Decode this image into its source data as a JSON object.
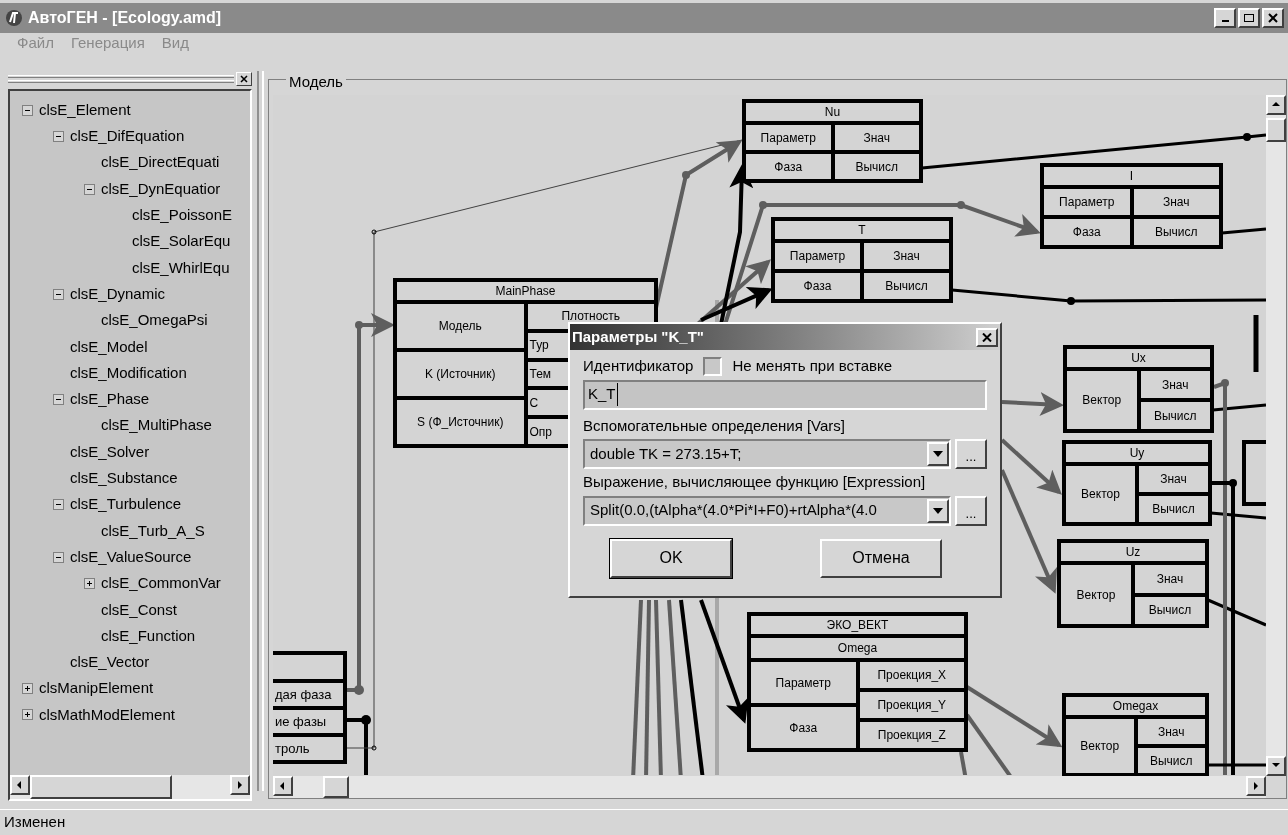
{
  "window": {
    "title": "АвтоГЕН - [Ecology.amd]"
  },
  "menu": [
    "Файл",
    "Генерация",
    "Вид"
  ],
  "tree": [
    {
      "label": "clsE_Element",
      "expanded": true,
      "children": [
        {
          "label": "clsE_DifEquation",
          "expanded": true,
          "children": [
            {
              "label": "clsE_DirectEquati"
            },
            {
              "label": "clsE_DynEquatior",
              "expanded": true,
              "children": [
                {
                  "label": "clsE_PoissonE"
                },
                {
                  "label": "clsE_SolarEqu"
                },
                {
                  "label": "clsE_WhirlEqu"
                }
              ]
            }
          ]
        },
        {
          "label": "clsE_Dynamic",
          "expanded": true,
          "children": [
            {
              "label": "clsE_OmegaPsi"
            }
          ]
        },
        {
          "label": "clsE_Model"
        },
        {
          "label": "clsE_Modification"
        },
        {
          "label": "clsE_Phase",
          "expanded": true,
          "children": [
            {
              "label": "clsE_MultiPhase"
            }
          ]
        },
        {
          "label": "clsE_Solver"
        },
        {
          "label": "clsE_Substance"
        },
        {
          "label": "clsE_Turbulence",
          "expanded": true,
          "children": [
            {
              "label": "clsE_Turb_A_S"
            }
          ]
        },
        {
          "label": "clsE_ValueSource",
          "expanded": true,
          "children": [
            {
              "label": "clsE_CommonVar",
              "expanded": false
            },
            {
              "label": "clsE_Const"
            },
            {
              "label": "clsE_Function"
            }
          ]
        },
        {
          "label": "clsE_Vector"
        }
      ]
    },
    {
      "label": "clsManipElement",
      "expanded": false
    },
    {
      "label": "clsMathModElement",
      "expanded": false
    }
  ],
  "model": {
    "title": "Модель",
    "nodes": [
      {
        "kind": "table",
        "title": "Nu",
        "left": [
          "Параметр",
          "Фаза"
        ],
        "right": [
          "Знач",
          "Вычисл"
        ]
      },
      {
        "kind": "table",
        "title": "I",
        "left": [
          "Параметр",
          "Фаза"
        ],
        "right": [
          "Знач",
          "Вычисл"
        ]
      },
      {
        "kind": "table",
        "title": "T",
        "left": [
          "Параметр",
          "Фаза"
        ],
        "right": [
          "Знач",
          "Вычисл"
        ]
      },
      {
        "kind": "table",
        "title": "MainPhase",
        "left": [
          "Модель",
          "K (Источник)",
          "S (Ф_Источник)"
        ],
        "right": [
          "Плотность",
          "Тур",
          "Тем",
          "С",
          "Опр"
        ]
      },
      {
        "kind": "table",
        "title": "Ux",
        "left": [
          "Вектор"
        ],
        "right": [
          "Знач",
          "Вычисл"
        ]
      },
      {
        "kind": "table",
        "title": "Uy",
        "left": [
          "Вектор"
        ],
        "right": [
          "Знач",
          "Вычисл"
        ]
      },
      {
        "kind": "table",
        "title": "Uz",
        "left": [
          "Вектор"
        ],
        "right": [
          "Знач",
          "Вычисл"
        ]
      },
      {
        "kind": "table",
        "title": "ЭКО_ВЕКТ",
        "subtitle": "Omega",
        "left": [
          "Параметр",
          "Фаза"
        ],
        "right": [
          "Проекция_X",
          "Проекция_Y",
          "Проекция_Z"
        ]
      },
      {
        "kind": "table",
        "title": "Omegax",
        "left": [
          "Вектор"
        ],
        "right": [
          "Знач",
          "Вычисл"
        ]
      },
      {
        "kind": "clipped",
        "cells": [
          "дая фаза",
          "ие фазы",
          "троль"
        ]
      }
    ]
  },
  "dialog": {
    "title": "Параметры \"K_T\"",
    "identifier_label": "Идентификатор",
    "keep_checkbox": {
      "label": "Не менять при вставке",
      "checked": false
    },
    "identifier_value": "K_T",
    "vars_label": "Вспомогательные определения [Vars]",
    "vars_value": "double TK = 273.15+T;",
    "expression_label": "Выражение, вычисляющее функцию [Expression]",
    "expression_value": "Split(0.0,(tAlpha*(4.0*Pi*I+F0)+rtAlpha*(4.0",
    "browse_button": [
      "...",
      "..."
    ],
    "buttons": [
      "OK",
      "Отмена"
    ]
  },
  "status_bar": "Изменен"
}
